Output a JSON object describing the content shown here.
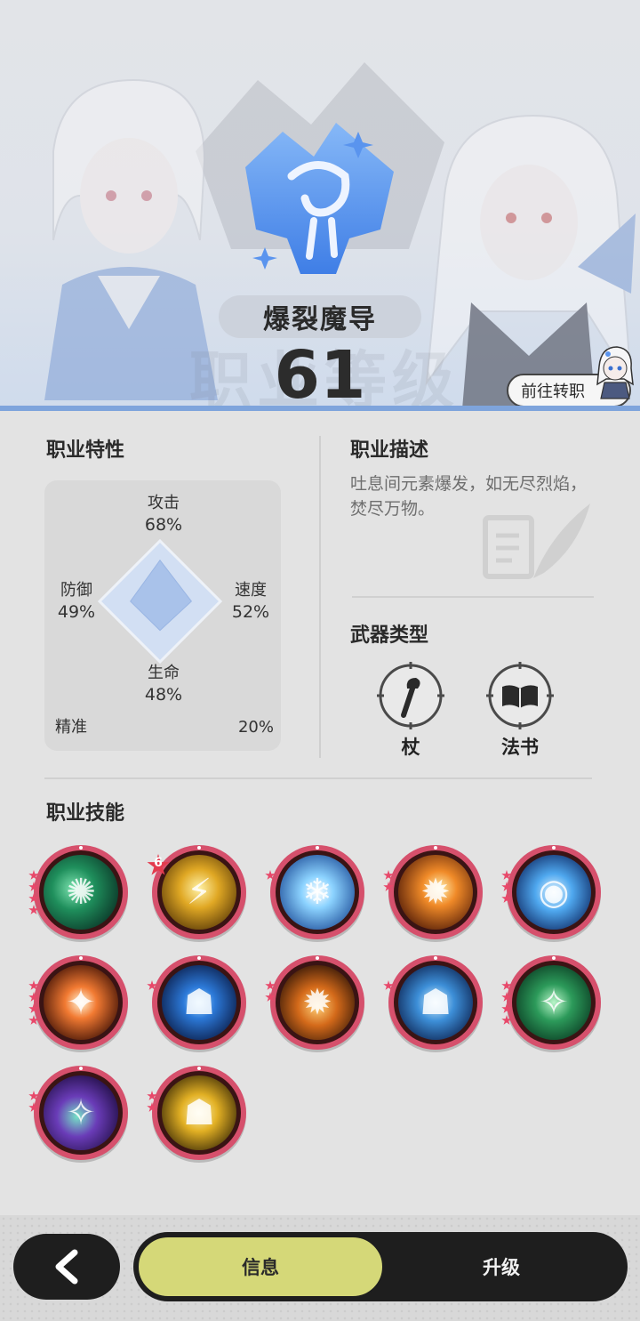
{
  "header": {
    "class_name": "爆裂魔导",
    "level": "61",
    "watermark": "职业等级",
    "job_change_label": "前往转职"
  },
  "traits": {
    "title": "职业特性",
    "attack": {
      "label": "攻击",
      "value": "68%"
    },
    "speed": {
      "label": "速度",
      "value": "52%"
    },
    "defense": {
      "label": "防御",
      "value": "49%"
    },
    "hp": {
      "label": "生命",
      "value": "48%"
    },
    "precision": {
      "label": "精准",
      "value": "20%"
    },
    "radar_values": {
      "attack": 0.68,
      "speed": 0.52,
      "hp": 0.48,
      "defense": 0.49
    }
  },
  "description": {
    "title": "职业描述",
    "text": "吐息间元素爆发，如无尽烈焰，焚尽万物。"
  },
  "weapons": {
    "title": "武器类型",
    "items": [
      {
        "label": "杖",
        "icon": "staff-icon"
      },
      {
        "label": "法书",
        "icon": "spellbook-icon"
      }
    ]
  },
  "skills": {
    "title": "职业技能",
    "badge_value": "6",
    "items": [
      {
        "icon": "wind-vortex-skill-icon",
        "stars": 4
      },
      {
        "icon": "lightning-strike-skill-icon",
        "stars": 0,
        "badge": true
      },
      {
        "icon": "ice-crystal-skill-icon",
        "stars": 1
      },
      {
        "icon": "fire-comet-skill-icon",
        "stars": 2
      },
      {
        "icon": "water-orb-skill-icon",
        "stars": 3
      },
      {
        "icon": "fire-vortex-skill-icon",
        "stars": 4
      },
      {
        "icon": "water-spirit-skill-icon",
        "stars": 1
      },
      {
        "icon": "fire-spirit-skill-icon",
        "stars": 2
      },
      {
        "icon": "water-shield-skill-icon",
        "stars": 1
      },
      {
        "icon": "nature-claw-skill-icon",
        "stars": 4
      },
      {
        "icon": "arcane-nebula-skill-icon",
        "stars": 2
      },
      {
        "icon": "light-aura-skill-icon",
        "stars": 2
      }
    ]
  },
  "nav": {
    "info_label": "信息",
    "upgrade_label": "升级",
    "active_tab": "信息"
  },
  "colors": {
    "accent_blue": "#7ea4dc",
    "emblem_blue": "#4f8ff0",
    "skill_ring": "#d6506c",
    "active_tab": "#d5d878",
    "bar_dark": "#1e1e1e"
  }
}
